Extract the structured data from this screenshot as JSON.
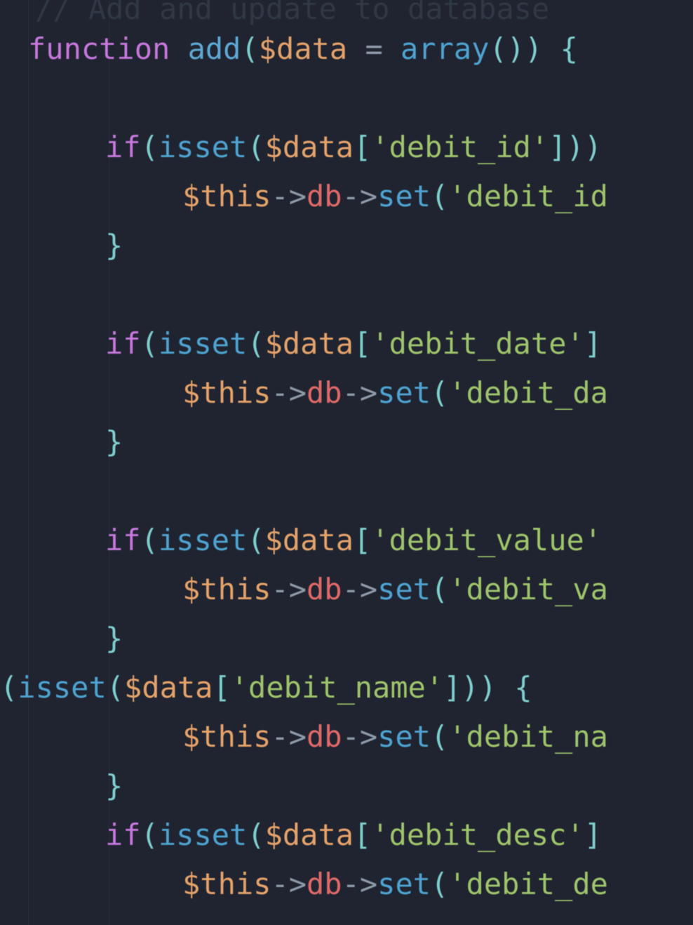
{
  "theme": {
    "background": "#1f2430",
    "keyword": "#c678dd",
    "functionDef": "#5fa8d3",
    "functionCall": "#4fa3d1",
    "variable": "#e5a36b",
    "property": "#e06a6a",
    "string": "#9fc46b",
    "punctuation": "#8e9aa9",
    "brace": "#7fcfcf",
    "comment": "#555f6d"
  },
  "language": "php",
  "commentFragment": "// Add and update to database",
  "lines": [
    {
      "indent": 0,
      "tokens": [
        {
          "t": "keyword",
          "v": "function"
        },
        {
          "t": "punct",
          "v": " "
        },
        {
          "t": "funcname",
          "v": "add"
        },
        {
          "t": "brace",
          "v": "("
        },
        {
          "t": "var",
          "v": "$data"
        },
        {
          "t": "punct",
          "v": " = "
        },
        {
          "t": "funccall",
          "v": "array"
        },
        {
          "t": "brace",
          "v": "()"
        },
        {
          "t": "brace",
          "v": ")"
        },
        {
          "t": "punct",
          "v": " "
        },
        {
          "t": "brace",
          "v": "{"
        }
      ]
    },
    {
      "indent": 1,
      "tokens": []
    },
    {
      "indent": 2,
      "tokens": [
        {
          "t": "keyword",
          "v": "if"
        },
        {
          "t": "brace",
          "v": "("
        },
        {
          "t": "funccall",
          "v": "isset"
        },
        {
          "t": "brace",
          "v": "("
        },
        {
          "t": "var",
          "v": "$data"
        },
        {
          "t": "brace",
          "v": "["
        },
        {
          "t": "string",
          "v": "'debit_id'"
        },
        {
          "t": "brace",
          "v": "]"
        },
        {
          "t": "brace",
          "v": ")"
        },
        {
          "t": "brace",
          "v": ")"
        }
      ]
    },
    {
      "indent": 4,
      "tokens": [
        {
          "t": "var",
          "v": "$this"
        },
        {
          "t": "arr",
          "v": "->"
        },
        {
          "t": "prop",
          "v": "db"
        },
        {
          "t": "arr",
          "v": "->"
        },
        {
          "t": "funccall",
          "v": "set"
        },
        {
          "t": "brace",
          "v": "("
        },
        {
          "t": "string",
          "v": "'debit_id"
        }
      ]
    },
    {
      "indent": 2,
      "tokens": [
        {
          "t": "brace",
          "v": "}"
        }
      ]
    },
    {
      "indent": 2,
      "tokens": []
    },
    {
      "indent": 2,
      "tokens": [
        {
          "t": "keyword",
          "v": "if"
        },
        {
          "t": "brace",
          "v": "("
        },
        {
          "t": "funccall",
          "v": "isset"
        },
        {
          "t": "brace",
          "v": "("
        },
        {
          "t": "var",
          "v": "$data"
        },
        {
          "t": "brace",
          "v": "["
        },
        {
          "t": "string",
          "v": "'debit_date'"
        },
        {
          "t": "brace",
          "v": "]"
        }
      ]
    },
    {
      "indent": 4,
      "tokens": [
        {
          "t": "var",
          "v": "$this"
        },
        {
          "t": "arr",
          "v": "->"
        },
        {
          "t": "prop",
          "v": "db"
        },
        {
          "t": "arr",
          "v": "->"
        },
        {
          "t": "funccall",
          "v": "set"
        },
        {
          "t": "brace",
          "v": "("
        },
        {
          "t": "string",
          "v": "'debit_da"
        }
      ]
    },
    {
      "indent": 2,
      "tokens": [
        {
          "t": "brace",
          "v": "}"
        }
      ]
    },
    {
      "indent": 2,
      "tokens": []
    },
    {
      "indent": 2,
      "tokens": [
        {
          "t": "keyword",
          "v": "if"
        },
        {
          "t": "brace",
          "v": "("
        },
        {
          "t": "funccall",
          "v": "isset"
        },
        {
          "t": "brace",
          "v": "("
        },
        {
          "t": "var",
          "v": "$data"
        },
        {
          "t": "brace",
          "v": "["
        },
        {
          "t": "string",
          "v": "'debit_value'"
        }
      ]
    },
    {
      "indent": 4,
      "tokens": [
        {
          "t": "var",
          "v": "$this"
        },
        {
          "t": "arr",
          "v": "->"
        },
        {
          "t": "prop",
          "v": "db"
        },
        {
          "t": "arr",
          "v": "->"
        },
        {
          "t": "funccall",
          "v": "set"
        },
        {
          "t": "brace",
          "v": "("
        },
        {
          "t": "string",
          "v": "'debit_va"
        }
      ]
    },
    {
      "indent": 2,
      "tokens": [
        {
          "t": "brace",
          "v": "}"
        }
      ]
    },
    {
      "indent": -2,
      "tokens": [
        {
          "t": "brace",
          "v": "("
        },
        {
          "t": "funccall",
          "v": "isset"
        },
        {
          "t": "brace",
          "v": "("
        },
        {
          "t": "var",
          "v": "$data"
        },
        {
          "t": "brace",
          "v": "["
        },
        {
          "t": "string",
          "v": "'debit_name'"
        },
        {
          "t": "brace",
          "v": "]"
        },
        {
          "t": "brace",
          "v": ")"
        },
        {
          "t": "brace",
          "v": ")"
        },
        {
          "t": "punct",
          "v": " "
        },
        {
          "t": "brace",
          "v": "{"
        }
      ]
    },
    {
      "indent": 4,
      "tokens": [
        {
          "t": "var",
          "v": "$this"
        },
        {
          "t": "arr",
          "v": "->"
        },
        {
          "t": "prop",
          "v": "db"
        },
        {
          "t": "arr",
          "v": "->"
        },
        {
          "t": "funccall",
          "v": "set"
        },
        {
          "t": "brace",
          "v": "("
        },
        {
          "t": "string",
          "v": "'debit_na"
        }
      ]
    },
    {
      "indent": 2,
      "tokens": [
        {
          "t": "brace",
          "v": "}"
        }
      ]
    },
    {
      "indent": 2,
      "tokens": [
        {
          "t": "keyword",
          "v": "if"
        },
        {
          "t": "brace",
          "v": "("
        },
        {
          "t": "funccall",
          "v": "isset"
        },
        {
          "t": "brace",
          "v": "("
        },
        {
          "t": "var",
          "v": "$data"
        },
        {
          "t": "brace",
          "v": "["
        },
        {
          "t": "string",
          "v": "'debit_desc'"
        },
        {
          "t": "brace",
          "v": "]"
        }
      ]
    },
    {
      "indent": 4,
      "tokens": [
        {
          "t": "var",
          "v": "$this"
        },
        {
          "t": "arr",
          "v": "->"
        },
        {
          "t": "prop",
          "v": "db"
        },
        {
          "t": "arr",
          "v": "->"
        },
        {
          "t": "funccall",
          "v": "set"
        },
        {
          "t": "brace",
          "v": "("
        },
        {
          "t": "string",
          "v": "'debit_de"
        }
      ]
    }
  ],
  "layout": {
    "fontSize": 42,
    "lineHeight": 70,
    "baseX": 40,
    "indentUnitPx": 55,
    "topOffset": 35,
    "commentTop": -22
  }
}
